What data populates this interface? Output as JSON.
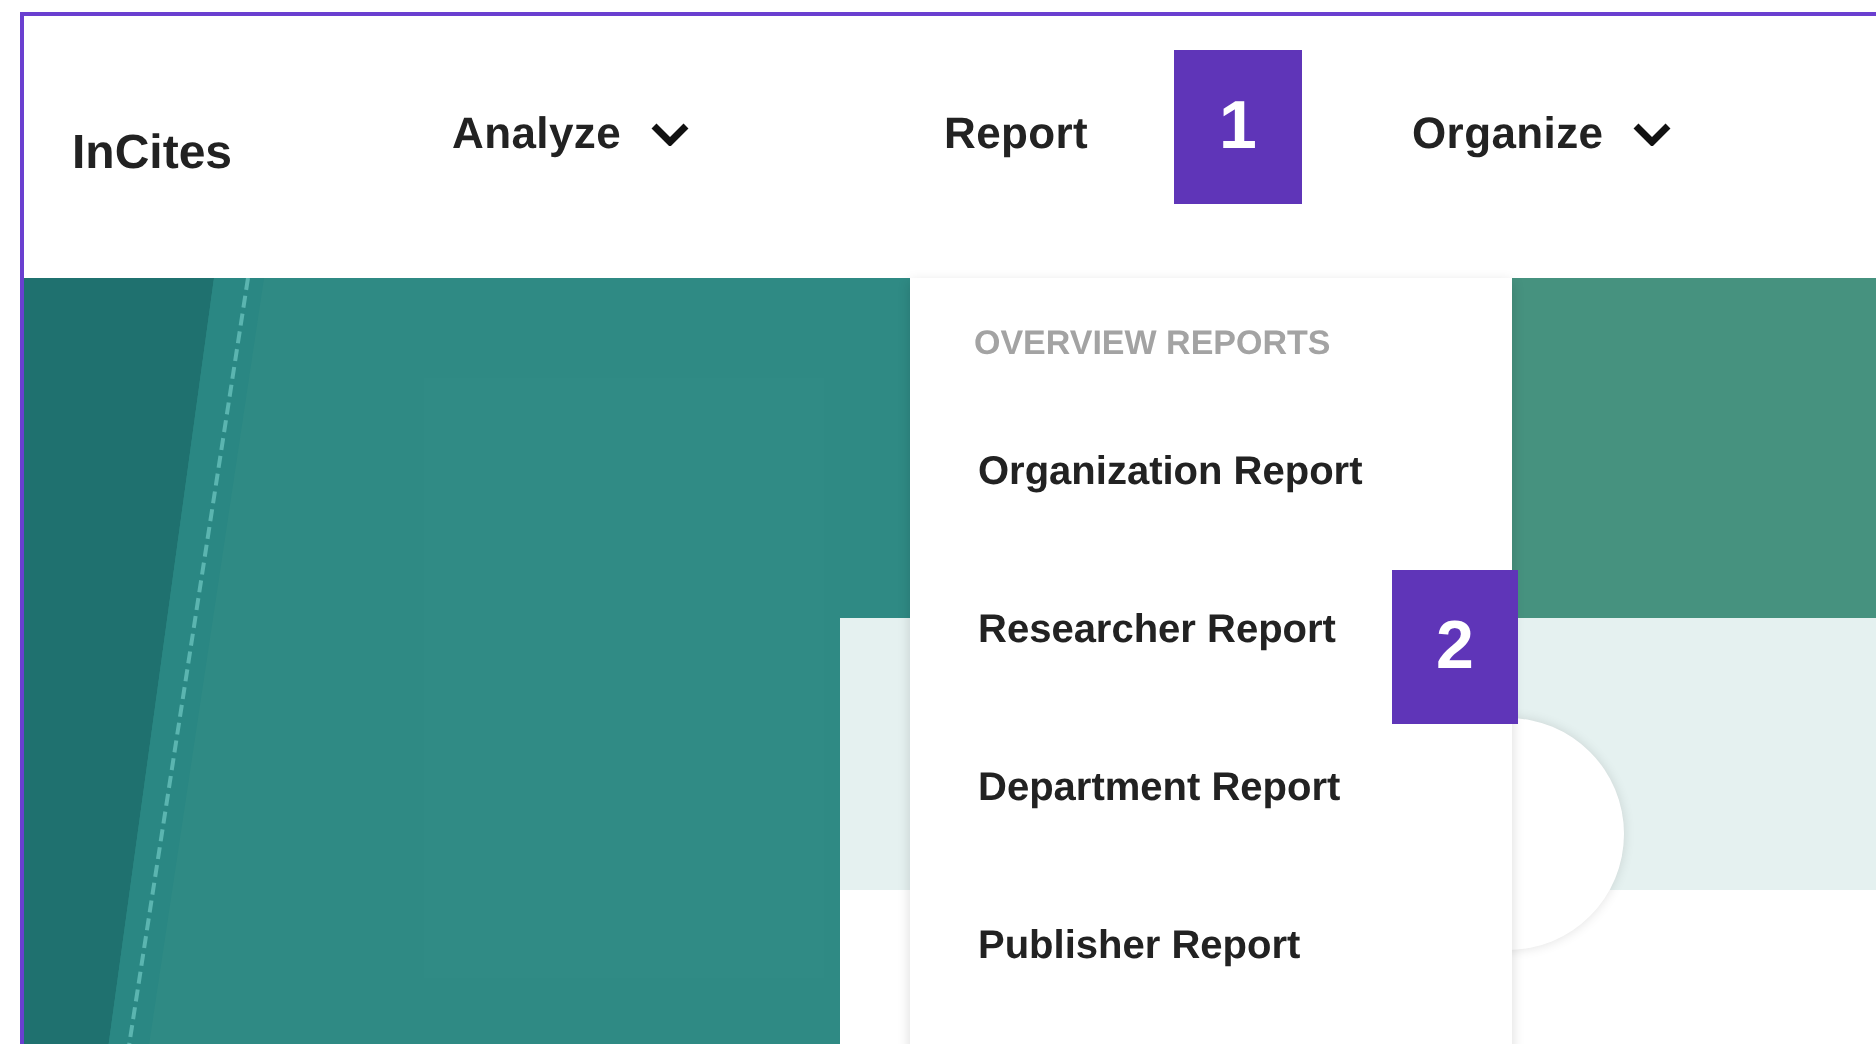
{
  "logo": "InCites",
  "nav": [
    {
      "label": "Analyze",
      "dropdown": true
    },
    {
      "label": "Report",
      "dropdown": false
    },
    {
      "label": "Organize",
      "dropdown": true
    }
  ],
  "menu": {
    "heading": "OVERVIEW REPORTS",
    "items": [
      "Organization Report",
      "Researcher Report",
      "Department Report",
      "Publisher Report"
    ]
  },
  "callouts": [
    "1",
    "2"
  ]
}
